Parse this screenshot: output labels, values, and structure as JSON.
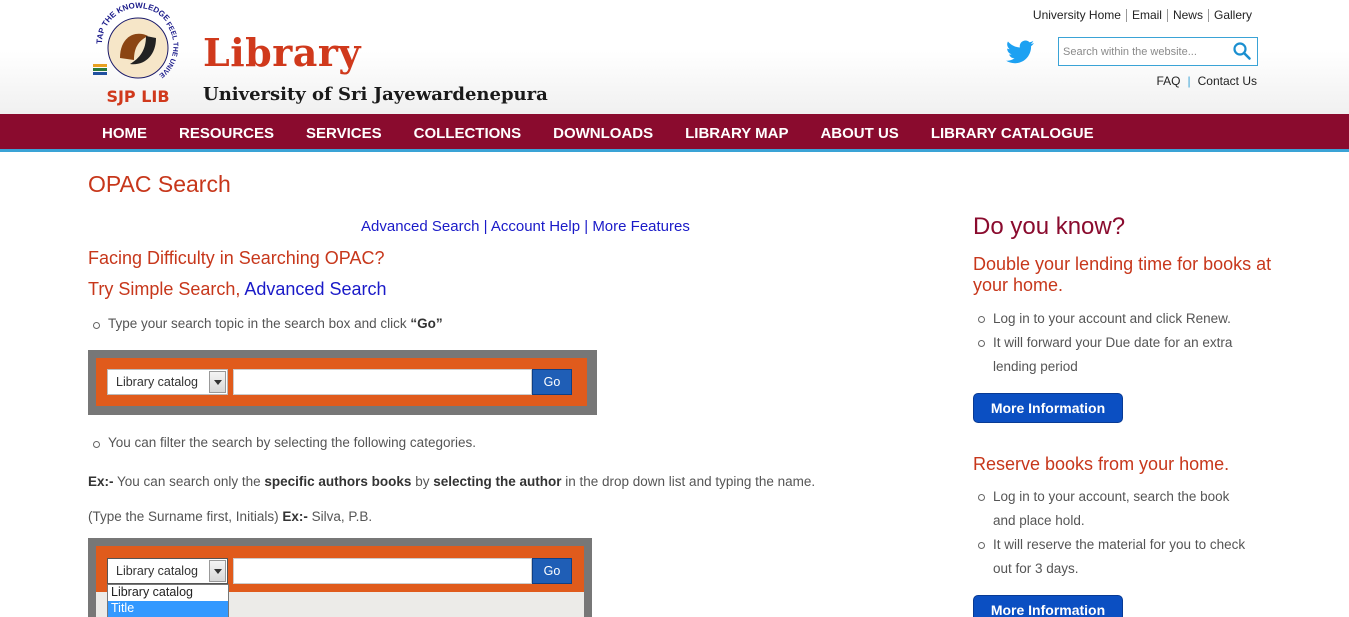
{
  "header": {
    "logo": {
      "top_text": "TAP THE KNOWLEDGE",
      "side_text": "FEEL THE UNIVERSE",
      "bottom_text": "SJP LIB"
    },
    "title": "Library",
    "subtitle": "University of Sri Jayewardenepura",
    "top_links": [
      "University Home",
      "Email",
      "News",
      "Gallery"
    ],
    "search_placeholder": "Search within the website...",
    "faq": "FAQ",
    "faq_sep": "|",
    "contact": "Contact Us"
  },
  "nav": {
    "items": [
      "HOME",
      "RESOURCES",
      "SERVICES",
      "COLLECTIONS",
      "DOWNLOADS",
      "LIBRARY MAP",
      "ABOUT US",
      "LIBRARY CATALOGUE"
    ]
  },
  "main": {
    "title": "OPAC Search",
    "links": {
      "advanced": "Advanced Search",
      "sep": "|",
      "account_help": "Account Help",
      "more_features": "More Features"
    },
    "difficulty_heading": "Facing Difficulty in Searching OPAC?",
    "try_heading_prefix": "Try Simple Search, ",
    "try_heading_link": "Advanced Search",
    "bullet1_text": "Type your search topic in the search box and click ",
    "bullet1_bold": "“Go”",
    "demo": {
      "select_value": "Library catalog",
      "go_label": "Go",
      "dropdown_options": [
        "Library catalog",
        "Title"
      ]
    },
    "bullet2": "You can filter the search by selecting the following categories.",
    "ex1": {
      "label": "Ex:-",
      "t1": " You can search only the ",
      "b1": "specific authors books",
      "t2": " by ",
      "b2": "selecting the author",
      "t3": " in the drop down list and typing the name."
    },
    "ex2": {
      "t1": "(Type the Surname first, Initials) ",
      "label": "Ex:-",
      "t2": " Silva, P.B."
    }
  },
  "sidebar": {
    "heading": "Do you know?",
    "block1": {
      "heading": "Double your lending time for books at your home.",
      "bullets": [
        "Log in to your account and click Renew.",
        "It will forward your Due date for an extra lending period"
      ],
      "button": "More Information"
    },
    "block2": {
      "heading": "Reserve books from your home.",
      "bullets": [
        "Log in to your account, search the book and place hold.",
        "It will reserve the material for you to check out for 3 days."
      ],
      "button": "More Information"
    }
  },
  "colors": {
    "nav_bg": "#8a0b2e",
    "accent_orange": "#c7371b",
    "link_blue": "#1a1ac8",
    "button_blue": "#0b4fc2",
    "twitter_blue": "#1da1f2"
  }
}
